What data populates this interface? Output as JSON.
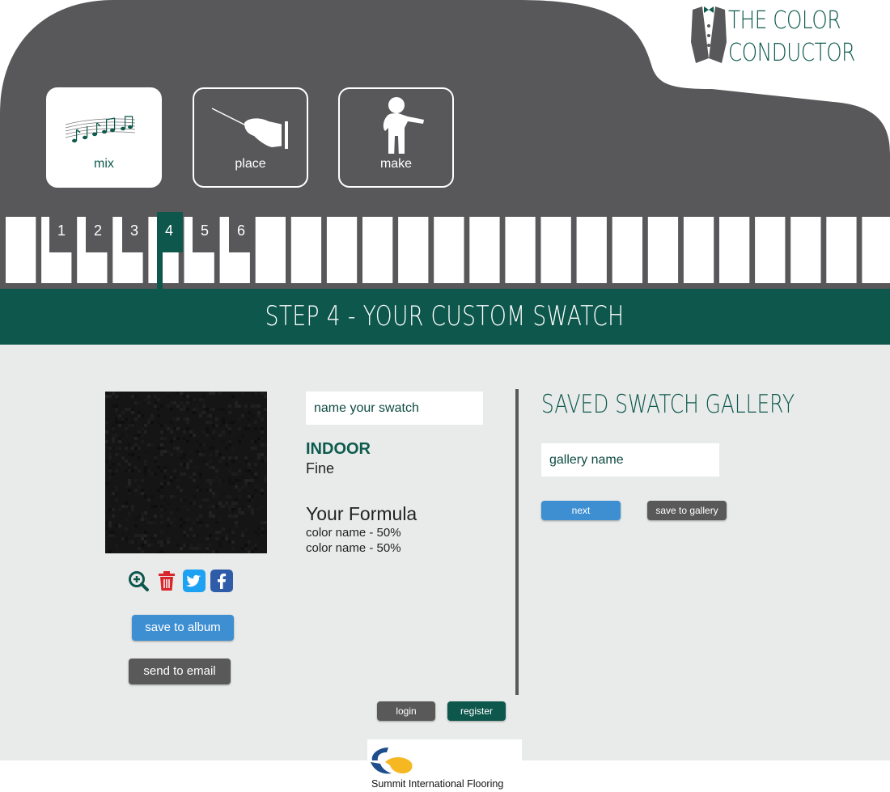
{
  "logo": {
    "line1": "THE COLOR",
    "line2": "CONDUCTOR"
  },
  "modes": [
    {
      "label": "mix",
      "icon": "music-notes-icon",
      "active": true
    },
    {
      "label": "place",
      "icon": "conductor-hand-icon",
      "active": false
    },
    {
      "label": "make",
      "icon": "person-icon",
      "active": false
    }
  ],
  "steps": [
    "1",
    "2",
    "3",
    "4",
    "5",
    "6"
  ],
  "current_step": "4",
  "banner": {
    "title": "STEP 4 - YOUR CUSTOM SWATCH"
  },
  "swatch": {
    "name_placeholder": "name your swatch",
    "category": "INDOOR",
    "texture": "Fine",
    "formula_title": "Your Formula",
    "formula": [
      "color name - 50%",
      "color name - 50%"
    ],
    "color": "#151515"
  },
  "actions": {
    "save_album": "save to album",
    "send_email": "send to email"
  },
  "gallery": {
    "title": "SAVED SWATCH GALLERY",
    "name_placeholder": "gallery name",
    "next": "next",
    "save": "save to gallery"
  },
  "auth": {
    "login": "login",
    "register": "register"
  },
  "footer": {
    "company": "Summit International Flooring"
  },
  "colors": {
    "piano": "#58585a",
    "brand_green": "#0e574c",
    "content_bg": "#e9ebea",
    "blue_button": "#3e8fd2",
    "gray_button": "#595959",
    "delete_red": "#d8262b",
    "twitter": "#1da1f2",
    "facebook": "#2f5ca8"
  }
}
